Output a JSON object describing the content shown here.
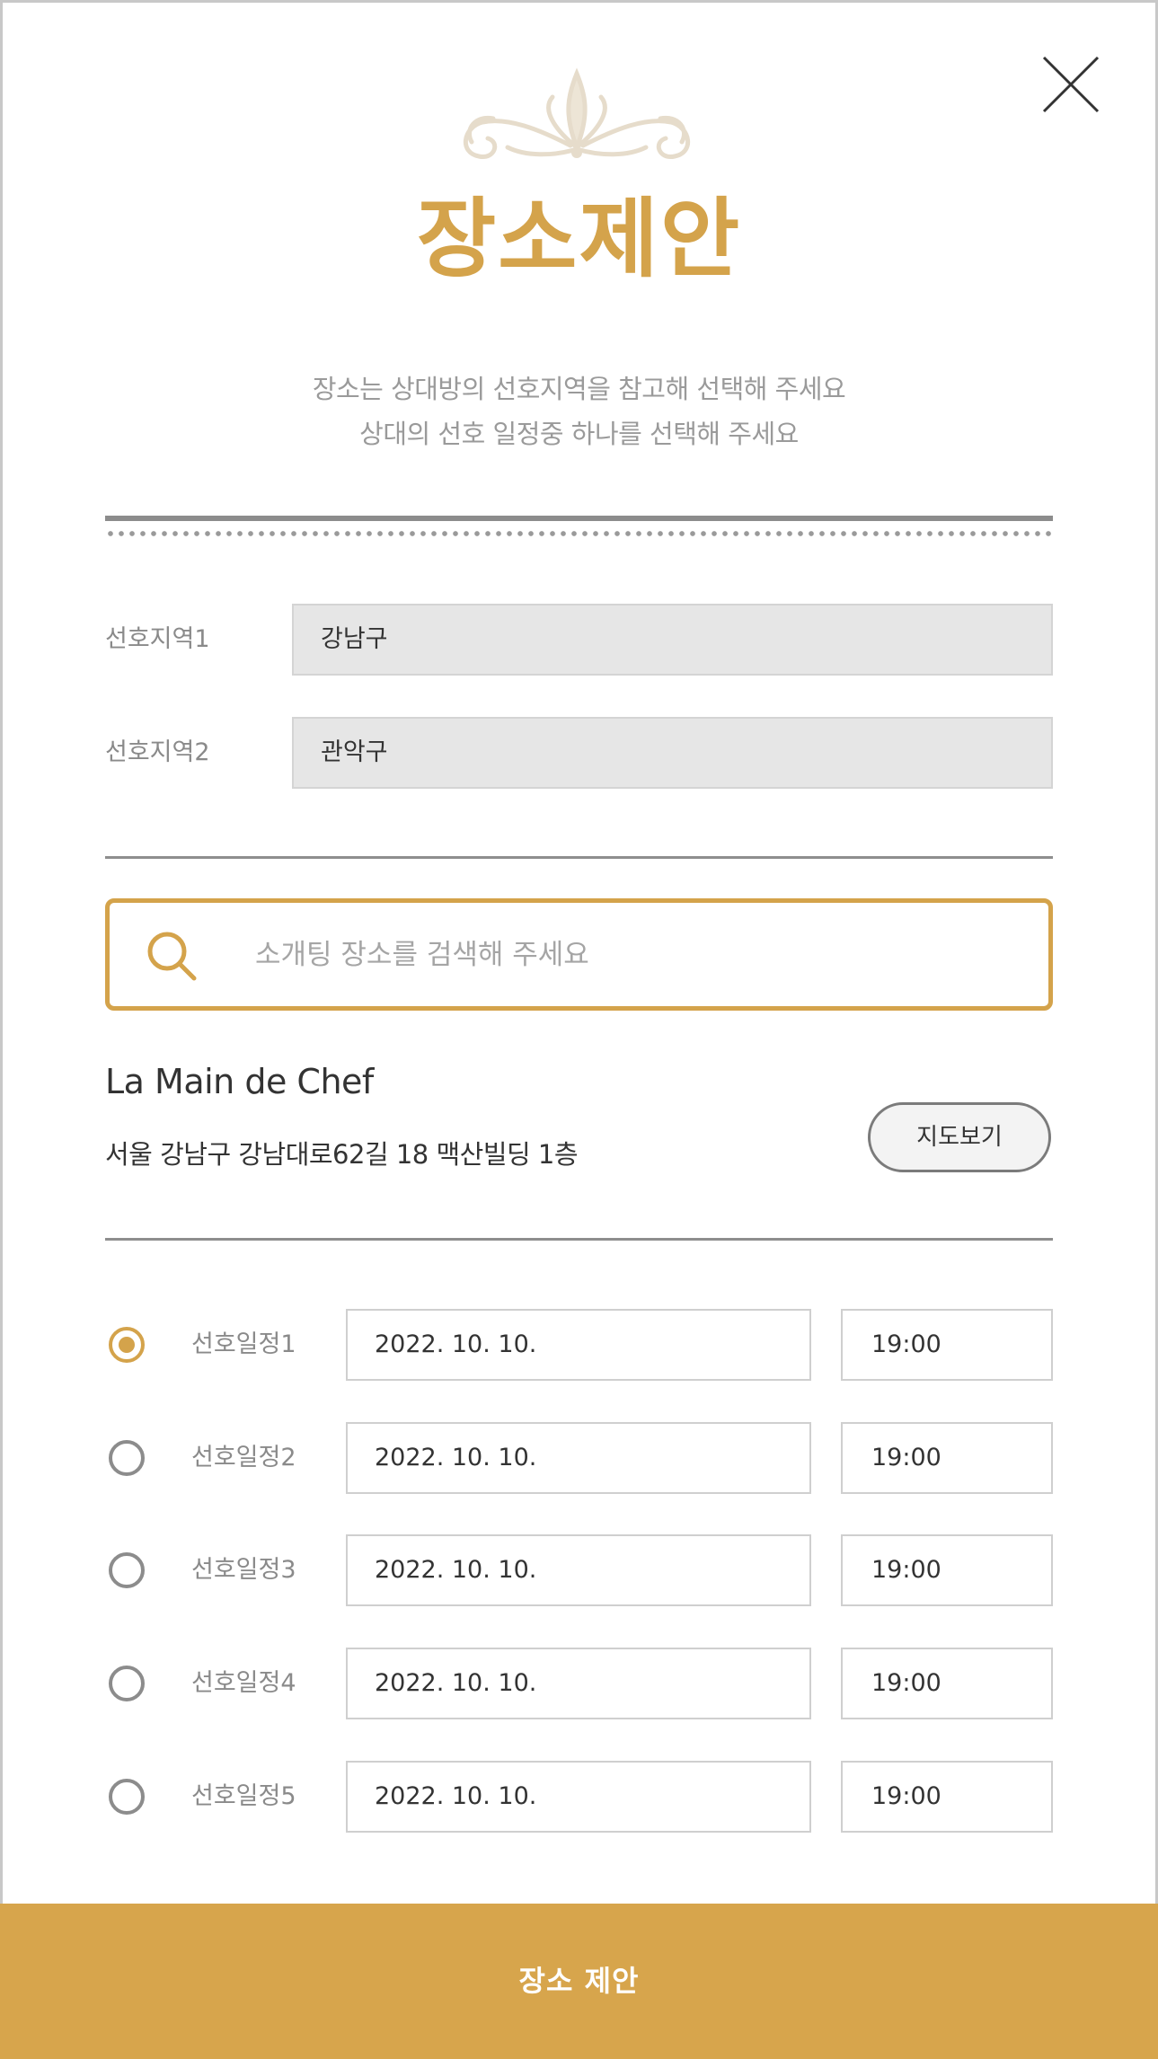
{
  "header": {
    "title": "장소제안",
    "subtitle_line1": "장소는 상대방의 선호지역을 참고해 선택해 주세요",
    "subtitle_line2": "상대의 선호 일정중 하나를 선택해 주세요",
    "close_icon": "close-icon",
    "ornament_icon": "ornament-flourish-icon"
  },
  "preferred_regions": [
    {
      "label": "선호지역1",
      "value": "강남구"
    },
    {
      "label": "선호지역2",
      "value": "관악구"
    }
  ],
  "search": {
    "placeholder": "소개팅 장소를 검색해 주세요",
    "value": "",
    "icon": "search-icon"
  },
  "place": {
    "name": "La Main de Chef",
    "address": "서울 강남구 강남대로62길 18 맥산빌딩 1층",
    "map_button_label": "지도보기"
  },
  "schedules": [
    {
      "label": "선호일정1",
      "date": "2022. 10. 10.",
      "time": "19:00",
      "selected": true
    },
    {
      "label": "선호일정2",
      "date": "2022. 10. 10.",
      "time": "19:00",
      "selected": false
    },
    {
      "label": "선호일정3",
      "date": "2022. 10. 10.",
      "time": "19:00",
      "selected": false
    },
    {
      "label": "선호일정4",
      "date": "2022. 10. 10.",
      "time": "19:00",
      "selected": false
    },
    {
      "label": "선호일정5",
      "date": "2022. 10. 10.",
      "time": "19:00",
      "selected": false
    }
  ],
  "submit_label": "장소 제안",
  "colors": {
    "accent": "#d4a34b",
    "button": "#d7a54c",
    "ornament": "#e8e0d0",
    "muted_text": "#9a9a9a",
    "field_bg": "#e6e6e6"
  }
}
